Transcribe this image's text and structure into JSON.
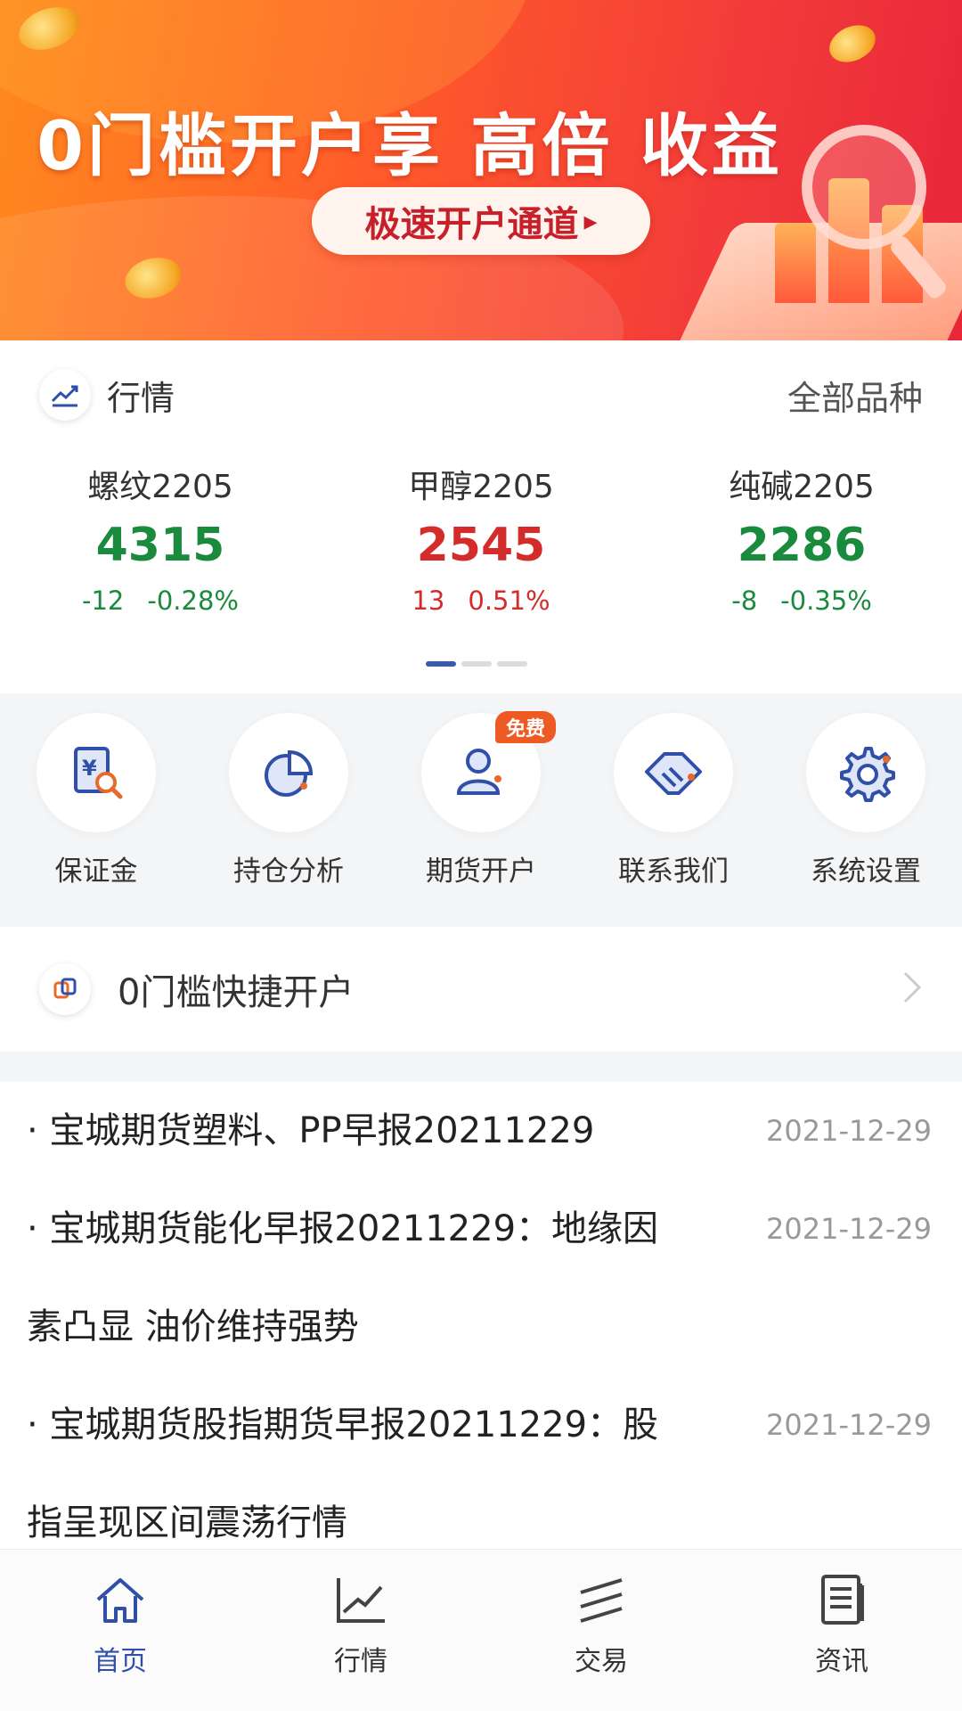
{
  "banner": {
    "headline": "0门槛开户享 高倍 收益",
    "cta_label": "极速开户通道",
    "cta_arrow": "▸"
  },
  "market": {
    "title": "行情",
    "all_link": "全部品种",
    "icon": "trend-chart-icon",
    "tickers": [
      {
        "name": "螺纹2205",
        "price": "4315",
        "change": "-12",
        "pct": "-0.28%",
        "color": "#1a8a3c"
      },
      {
        "name": "甲醇2205",
        "price": "2545",
        "change": "13",
        "pct": "0.51%",
        "color": "#d42b2b"
      },
      {
        "name": "纯碱2205",
        "price": "2286",
        "change": "-8",
        "pct": "-0.35%",
        "color": "#1a8a3c"
      }
    ],
    "page_indicator": {
      "pages": 3,
      "active": 1
    }
  },
  "quick_menu": {
    "items": [
      {
        "label": "保证金",
        "icon": "margin-doc-icon"
      },
      {
        "label": "持仓分析",
        "icon": "pie-chart-icon"
      },
      {
        "label": "期货开户",
        "icon": "user-account-icon",
        "badge": "免费"
      },
      {
        "label": "联系我们",
        "icon": "handshake-icon"
      },
      {
        "label": "系统设置",
        "icon": "gear-icon"
      }
    ]
  },
  "fast_open": {
    "label": "0门槛快捷开户",
    "icon": "link-icon"
  },
  "news": {
    "items": [
      {
        "title": "· 宝城期货塑料、PP早报20211229",
        "date": "2021-12-29"
      },
      {
        "title_line1": "· 宝城期货能化早报20211229：地缘因",
        "title_line2": "素凸显 油价维持强势",
        "date": "2021-12-29"
      },
      {
        "title_line1": "· 宝城期货股指期货早报20211229：股",
        "title_line2": "指呈现区间震荡行情",
        "date": "2021-12-29"
      }
    ]
  },
  "tabbar": {
    "tabs": [
      {
        "label": "首页",
        "icon": "home-icon",
        "active": true
      },
      {
        "label": "行情",
        "icon": "line-chart-icon"
      },
      {
        "label": "交易",
        "icon": "trade-icon"
      },
      {
        "label": "资讯",
        "icon": "news-icon"
      }
    ],
    "active_color": "#2f4fa8"
  }
}
